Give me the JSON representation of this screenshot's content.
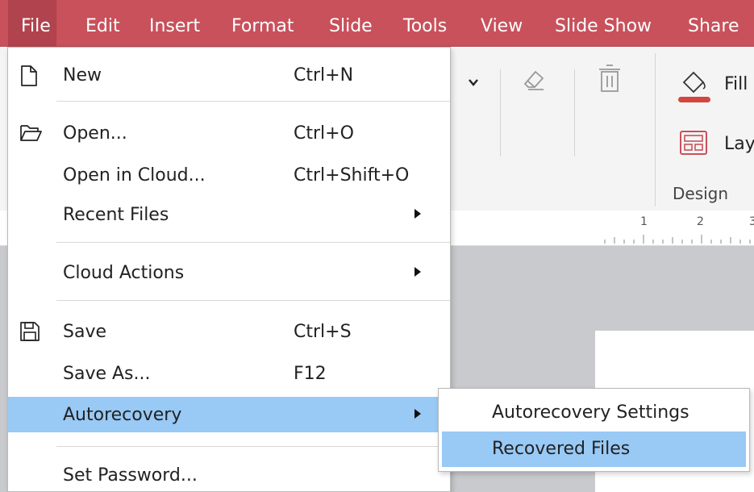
{
  "menubar": {
    "items": [
      "File",
      "Edit",
      "Insert",
      "Format",
      "Slide",
      "Tools",
      "View",
      "Slide Show",
      "Share"
    ],
    "active": "File",
    "color": "#c8515b"
  },
  "ribbon": {
    "fill_label": "Fill",
    "layout_label": "Lay",
    "group_label": "Design",
    "icons": [
      "chevron-down-icon",
      "eraser-icon",
      "trash-icon",
      "fill-color-icon",
      "layout-icon"
    ]
  },
  "ruler": {
    "numbers": [
      "1",
      "2",
      "3"
    ]
  },
  "file_menu": {
    "items": [
      {
        "label": "New",
        "shortcut": "Ctrl+N",
        "icon": "new-document-icon"
      },
      {
        "label": "Open...",
        "shortcut": "Ctrl+O",
        "icon": "open-folder-icon"
      },
      {
        "label": "Open in Cloud...",
        "shortcut": "Ctrl+Shift+O"
      },
      {
        "label": "Recent Files",
        "submenu": true
      },
      {
        "label": "Cloud Actions",
        "submenu": true
      },
      {
        "label": "Save",
        "shortcut": "Ctrl+S",
        "icon": "save-icon"
      },
      {
        "label": "Save As...",
        "shortcut": "F12"
      },
      {
        "label": "Autorecovery",
        "submenu": true,
        "highlighted": true
      },
      {
        "label": "Set Password..."
      }
    ]
  },
  "autorecovery_submenu": {
    "items": [
      {
        "label": "Autorecovery Settings"
      },
      {
        "label": "Recovered Files",
        "highlighted": true
      }
    ]
  },
  "colors": {
    "highlight": "#99c9f5",
    "accent": "#c8515b"
  }
}
